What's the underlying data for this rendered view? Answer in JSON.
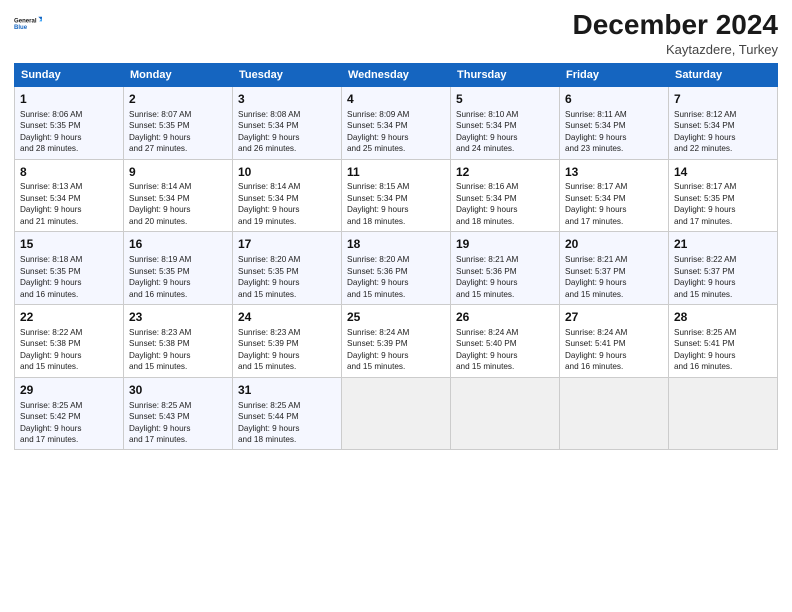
{
  "logo": {
    "line1": "General",
    "line2": "Blue"
  },
  "title": "December 2024",
  "location": "Kaytazdere, Turkey",
  "days_of_week": [
    "Sunday",
    "Monday",
    "Tuesday",
    "Wednesday",
    "Thursday",
    "Friday",
    "Saturday"
  ],
  "weeks": [
    [
      {
        "day": 1,
        "lines": [
          "Sunrise: 8:06 AM",
          "Sunset: 5:35 PM",
          "Daylight: 9 hours",
          "and 28 minutes."
        ]
      },
      {
        "day": 2,
        "lines": [
          "Sunrise: 8:07 AM",
          "Sunset: 5:35 PM",
          "Daylight: 9 hours",
          "and 27 minutes."
        ]
      },
      {
        "day": 3,
        "lines": [
          "Sunrise: 8:08 AM",
          "Sunset: 5:34 PM",
          "Daylight: 9 hours",
          "and 26 minutes."
        ]
      },
      {
        "day": 4,
        "lines": [
          "Sunrise: 8:09 AM",
          "Sunset: 5:34 PM",
          "Daylight: 9 hours",
          "and 25 minutes."
        ]
      },
      {
        "day": 5,
        "lines": [
          "Sunrise: 8:10 AM",
          "Sunset: 5:34 PM",
          "Daylight: 9 hours",
          "and 24 minutes."
        ]
      },
      {
        "day": 6,
        "lines": [
          "Sunrise: 8:11 AM",
          "Sunset: 5:34 PM",
          "Daylight: 9 hours",
          "and 23 minutes."
        ]
      },
      {
        "day": 7,
        "lines": [
          "Sunrise: 8:12 AM",
          "Sunset: 5:34 PM",
          "Daylight: 9 hours",
          "and 22 minutes."
        ]
      }
    ],
    [
      {
        "day": 8,
        "lines": [
          "Sunrise: 8:13 AM",
          "Sunset: 5:34 PM",
          "Daylight: 9 hours",
          "and 21 minutes."
        ]
      },
      {
        "day": 9,
        "lines": [
          "Sunrise: 8:14 AM",
          "Sunset: 5:34 PM",
          "Daylight: 9 hours",
          "and 20 minutes."
        ]
      },
      {
        "day": 10,
        "lines": [
          "Sunrise: 8:14 AM",
          "Sunset: 5:34 PM",
          "Daylight: 9 hours",
          "and 19 minutes."
        ]
      },
      {
        "day": 11,
        "lines": [
          "Sunrise: 8:15 AM",
          "Sunset: 5:34 PM",
          "Daylight: 9 hours",
          "and 18 minutes."
        ]
      },
      {
        "day": 12,
        "lines": [
          "Sunrise: 8:16 AM",
          "Sunset: 5:34 PM",
          "Daylight: 9 hours",
          "and 18 minutes."
        ]
      },
      {
        "day": 13,
        "lines": [
          "Sunrise: 8:17 AM",
          "Sunset: 5:34 PM",
          "Daylight: 9 hours",
          "and 17 minutes."
        ]
      },
      {
        "day": 14,
        "lines": [
          "Sunrise: 8:17 AM",
          "Sunset: 5:35 PM",
          "Daylight: 9 hours",
          "and 17 minutes."
        ]
      }
    ],
    [
      {
        "day": 15,
        "lines": [
          "Sunrise: 8:18 AM",
          "Sunset: 5:35 PM",
          "Daylight: 9 hours",
          "and 16 minutes."
        ]
      },
      {
        "day": 16,
        "lines": [
          "Sunrise: 8:19 AM",
          "Sunset: 5:35 PM",
          "Daylight: 9 hours",
          "and 16 minutes."
        ]
      },
      {
        "day": 17,
        "lines": [
          "Sunrise: 8:20 AM",
          "Sunset: 5:35 PM",
          "Daylight: 9 hours",
          "and 15 minutes."
        ]
      },
      {
        "day": 18,
        "lines": [
          "Sunrise: 8:20 AM",
          "Sunset: 5:36 PM",
          "Daylight: 9 hours",
          "and 15 minutes."
        ]
      },
      {
        "day": 19,
        "lines": [
          "Sunrise: 8:21 AM",
          "Sunset: 5:36 PM",
          "Daylight: 9 hours",
          "and 15 minutes."
        ]
      },
      {
        "day": 20,
        "lines": [
          "Sunrise: 8:21 AM",
          "Sunset: 5:37 PM",
          "Daylight: 9 hours",
          "and 15 minutes."
        ]
      },
      {
        "day": 21,
        "lines": [
          "Sunrise: 8:22 AM",
          "Sunset: 5:37 PM",
          "Daylight: 9 hours",
          "and 15 minutes."
        ]
      }
    ],
    [
      {
        "day": 22,
        "lines": [
          "Sunrise: 8:22 AM",
          "Sunset: 5:38 PM",
          "Daylight: 9 hours",
          "and 15 minutes."
        ]
      },
      {
        "day": 23,
        "lines": [
          "Sunrise: 8:23 AM",
          "Sunset: 5:38 PM",
          "Daylight: 9 hours",
          "and 15 minutes."
        ]
      },
      {
        "day": 24,
        "lines": [
          "Sunrise: 8:23 AM",
          "Sunset: 5:39 PM",
          "Daylight: 9 hours",
          "and 15 minutes."
        ]
      },
      {
        "day": 25,
        "lines": [
          "Sunrise: 8:24 AM",
          "Sunset: 5:39 PM",
          "Daylight: 9 hours",
          "and 15 minutes."
        ]
      },
      {
        "day": 26,
        "lines": [
          "Sunrise: 8:24 AM",
          "Sunset: 5:40 PM",
          "Daylight: 9 hours",
          "and 15 minutes."
        ]
      },
      {
        "day": 27,
        "lines": [
          "Sunrise: 8:24 AM",
          "Sunset: 5:41 PM",
          "Daylight: 9 hours",
          "and 16 minutes."
        ]
      },
      {
        "day": 28,
        "lines": [
          "Sunrise: 8:25 AM",
          "Sunset: 5:41 PM",
          "Daylight: 9 hours",
          "and 16 minutes."
        ]
      }
    ],
    [
      {
        "day": 29,
        "lines": [
          "Sunrise: 8:25 AM",
          "Sunset: 5:42 PM",
          "Daylight: 9 hours",
          "and 17 minutes."
        ]
      },
      {
        "day": 30,
        "lines": [
          "Sunrise: 8:25 AM",
          "Sunset: 5:43 PM",
          "Daylight: 9 hours",
          "and 17 minutes."
        ]
      },
      {
        "day": 31,
        "lines": [
          "Sunrise: 8:25 AM",
          "Sunset: 5:44 PM",
          "Daylight: 9 hours",
          "and 18 minutes."
        ]
      },
      null,
      null,
      null,
      null
    ]
  ]
}
